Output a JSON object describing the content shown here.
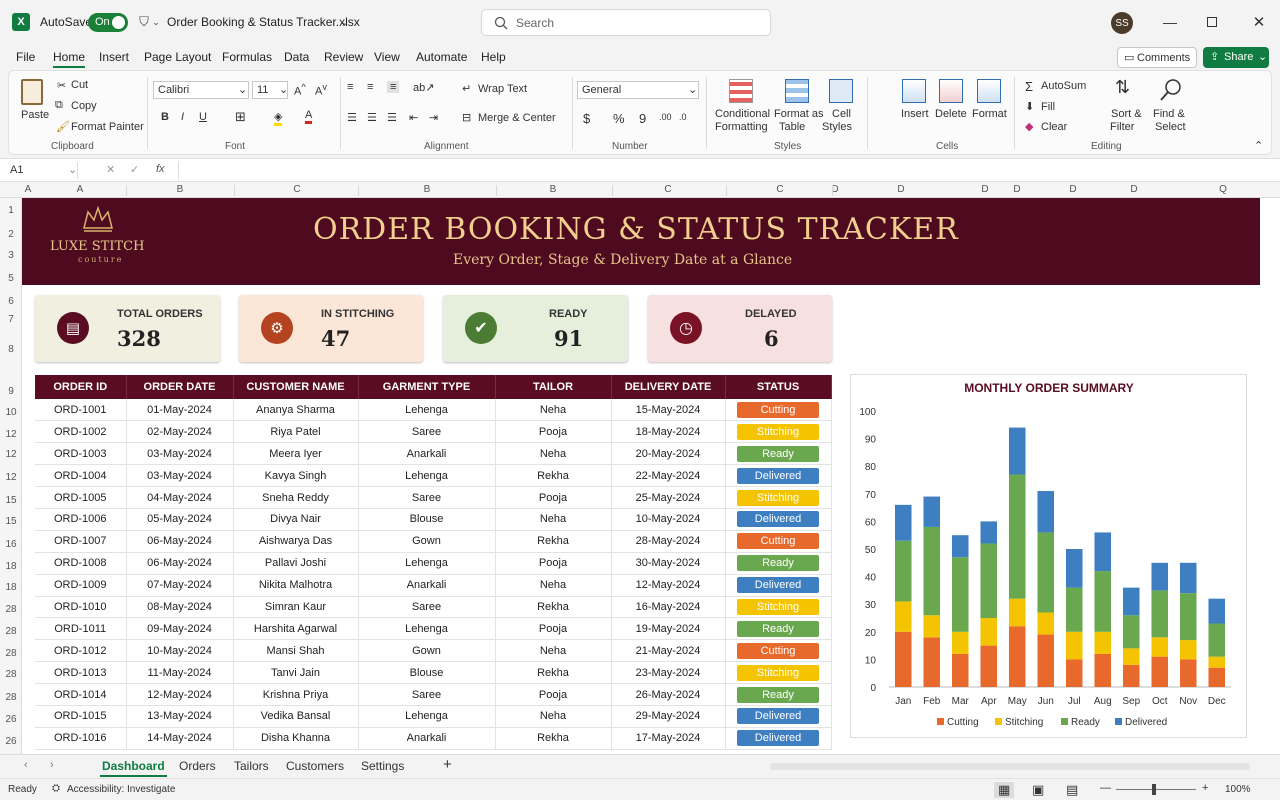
{
  "titlebar": {
    "autosave_label": "AutoSave",
    "autosave_state": "On",
    "file_name": "Order Booking & Status Tracker.xlsx",
    "search_placeholder": "Search",
    "user_initials": "SS"
  },
  "menu": {
    "items": [
      "File",
      "Home",
      "Insert",
      "Page Layout",
      "Formulas",
      "Data",
      "Review",
      "View",
      "Automate",
      "Help"
    ],
    "active": "Home",
    "comments": "Comments",
    "share": "Share"
  },
  "ribbon": {
    "clipboard": {
      "paste": "Paste",
      "cut": "Cut",
      "copy": "Copy",
      "format_painter": "Format Painter",
      "group": "Clipboard"
    },
    "font": {
      "name": "Calibri",
      "size": "11",
      "group": "Font"
    },
    "alignment": {
      "wrap": "Wrap Text",
      "merge": "Merge & Center",
      "group": "Alignment"
    },
    "number": {
      "format": "General",
      "group": "Number"
    },
    "styles": {
      "conditional": "Conditional",
      "conditional2": "Formatting",
      "format_as": "Format as",
      "format_as2": "Table",
      "cell": "Cell",
      "cell2": "Styles",
      "group": "Styles"
    },
    "cells": {
      "insert": "Insert",
      "delete": "Delete",
      "format": "Format",
      "group": "Cells"
    },
    "editing": {
      "autosum": "AutoSum",
      "fill": "Fill",
      "clear": "Clear",
      "sort": "Sort &",
      "sort2": "Filter",
      "find": "Find &",
      "find2": "Select",
      "group": "Editing"
    }
  },
  "formula": {
    "cell_ref": "A1",
    "fx": "fx"
  },
  "columns": [
    "A",
    "A",
    "B",
    "C",
    "B",
    "B",
    "C",
    "C",
    "D",
    "D",
    "D",
    "D",
    "D",
    "D",
    "Q"
  ],
  "rows": [
    "1",
    "2",
    "3",
    "5",
    "6",
    "7",
    "8",
    "9",
    "10",
    "12",
    "12",
    "12",
    "15",
    "15",
    "16",
    "18",
    "18",
    "28",
    "28",
    "28",
    "28",
    "28",
    "26",
    "26"
  ],
  "banner": {
    "logo_line1": "LUXE STITCH",
    "logo_line2": "couture",
    "title": "ORDER BOOKING & STATUS TRACKER",
    "subtitle": "Every Order, Stage & Delivery Date at a Glance"
  },
  "kpis": [
    {
      "label": "TOTAL ORDERS",
      "value": "328",
      "bg": "#f1efdf",
      "accent": "#5a0c22"
    },
    {
      "label": "IN STITCHING",
      "value": "47",
      "bg": "#fbe6d8",
      "accent": "#b4431f"
    },
    {
      "label": "READY",
      "value": "91",
      "bg": "#e6efdc",
      "accent": "#4c7c34"
    },
    {
      "label": "DELAYED",
      "value": "6",
      "bg": "#f7e0e0",
      "accent": "#7a1226"
    }
  ],
  "table": {
    "headers": [
      "ORDER ID",
      "ORDER DATE",
      "CUSTOMER NAME",
      "GARMENT TYPE",
      "TAILOR",
      "DELIVERY DATE",
      "STATUS"
    ],
    "rows": [
      [
        "ORD-1001",
        "01-May-2024",
        "Ananya Sharma",
        "Lehenga",
        "Neha",
        "15-May-2024",
        "Cutting"
      ],
      [
        "ORD-1002",
        "02-May-2024",
        "Riya Patel",
        "Saree",
        "Pooja",
        "18-May-2024",
        "Stitching"
      ],
      [
        "ORD-1003",
        "03-May-2024",
        "Meera Iyer",
        "Anarkali",
        "Neha",
        "20-May-2024",
        "Ready"
      ],
      [
        "ORD-1004",
        "03-May-2024",
        "Kavya Singh",
        "Lehenga",
        "Rekha",
        "22-May-2024",
        "Delivered"
      ],
      [
        "ORD-1005",
        "04-May-2024",
        "Sneha Reddy",
        "Saree",
        "Pooja",
        "25-May-2024",
        "Stitching"
      ],
      [
        "ORD-1006",
        "05-May-2024",
        "Divya Nair",
        "Blouse",
        "Neha",
        "10-May-2024",
        "Delivered"
      ],
      [
        "ORD-1007",
        "06-May-2024",
        "Aishwarya Das",
        "Gown",
        "Rekha",
        "28-May-2024",
        "Cutting"
      ],
      [
        "ORD-1008",
        "06-May-2024",
        "Pallavi Joshi",
        "Lehenga",
        "Pooja",
        "30-May-2024",
        "Ready"
      ],
      [
        "ORD-1009",
        "07-May-2024",
        "Nikita Malhotra",
        "Anarkali",
        "Neha",
        "12-May-2024",
        "Delivered"
      ],
      [
        "ORD-1010",
        "08-May-2024",
        "Simran Kaur",
        "Saree",
        "Rekha",
        "16-May-2024",
        "Stitching"
      ],
      [
        "ORD-1011",
        "09-May-2024",
        "Harshita Agarwal",
        "Lehenga",
        "Pooja",
        "19-May-2024",
        "Ready"
      ],
      [
        "ORD-1012",
        "10-May-2024",
        "Mansi Shah",
        "Gown",
        "Neha",
        "21-May-2024",
        "Cutting"
      ],
      [
        "ORD-1013",
        "11-May-2024",
        "Tanvi Jain",
        "Blouse",
        "Rekha",
        "23-May-2024",
        "Stitching"
      ],
      [
        "ORD-1014",
        "12-May-2024",
        "Krishna Priya",
        "Saree",
        "Pooja",
        "26-May-2024",
        "Ready"
      ],
      [
        "ORD-1015",
        "13-May-2024",
        "Vedika Bansal",
        "Lehenga",
        "Neha",
        "29-May-2024",
        "Delivered"
      ],
      [
        "ORD-1016",
        "14-May-2024",
        "Disha Khanna",
        "Anarkali",
        "Rekha",
        "17-May-2024",
        "Delivered"
      ]
    ],
    "status_colors": {
      "Cutting": "#e8692c",
      "Stitching": "#f5c400",
      "Ready": "#6aa84f",
      "Delivered": "#3d7fc1"
    }
  },
  "chart_data": {
    "type": "bar",
    "stacked": true,
    "title": "MONTHLY ORDER SUMMARY",
    "categories": [
      "Jan",
      "Feb",
      "Mar",
      "Apr",
      "May",
      "Jun",
      "Jul",
      "Aug",
      "Sep",
      "Oct",
      "Nov",
      "Dec"
    ],
    "series": [
      {
        "name": "Cutting",
        "color": "#e8692c",
        "values": [
          20,
          18,
          12,
          15,
          22,
          19,
          10,
          12,
          8,
          11,
          10,
          7
        ]
      },
      {
        "name": "Stitching",
        "color": "#f5c400",
        "values": [
          11,
          8,
          8,
          10,
          10,
          8,
          10,
          8,
          6,
          7,
          7,
          4
        ]
      },
      {
        "name": "Ready",
        "color": "#6aa84f",
        "values": [
          22,
          32,
          27,
          27,
          45,
          29,
          16,
          22,
          12,
          17,
          17,
          12
        ]
      },
      {
        "name": "Delivered",
        "color": "#3d7fc1",
        "values": [
          13,
          11,
          8,
          8,
          17,
          15,
          14,
          14,
          10,
          10,
          11,
          9
        ]
      }
    ],
    "ylim": [
      0,
      100
    ],
    "yticks": [
      0,
      10,
      20,
      30,
      40,
      50,
      60,
      70,
      80,
      90,
      100
    ],
    "legend": "bottom",
    "grid": false
  },
  "sheet_tabs": {
    "items": [
      "Dashboard",
      "Orders",
      "Tailors",
      "Customers",
      "Settings"
    ],
    "active": "Dashboard",
    "add": "+"
  },
  "status": {
    "ready": "Ready",
    "accessibility": "Accessibility: Investigate",
    "zoom": "100%"
  }
}
